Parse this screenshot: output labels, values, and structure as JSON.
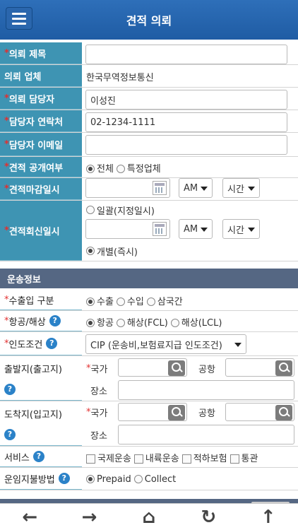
{
  "header": {
    "title": "견적 의뢰",
    "menu_icon": "hamburger-icon"
  },
  "fields": {
    "req_title": {
      "label": "의뢰 제목",
      "value": ""
    },
    "req_company": {
      "label": "의뢰 업체",
      "value": "한국무역정보통신"
    },
    "req_manager": {
      "label": "의뢰 담당자",
      "value": "이성진"
    },
    "contact": {
      "label": "담당자 연락처",
      "value": "02-1234-1111"
    },
    "email": {
      "label": "담당자 이메일",
      "value": ""
    },
    "open": {
      "label": "견적 공개여부",
      "opt1": "전체",
      "opt2": "특정업체"
    },
    "deadline": {
      "label": "견적마감일시",
      "ampm": "AM",
      "time": "시간"
    },
    "reply": {
      "label": "견적회신일시",
      "opt1": "일괄(지정일시)",
      "ampm": "AM",
      "time": "시간",
      "opt2": "개별(즉시)"
    }
  },
  "section": {
    "title": "운송정보"
  },
  "transport": {
    "io": {
      "label": "수출입 구분",
      "opt1": "수출",
      "opt2": "수입",
      "opt3": "삼국간"
    },
    "mode": {
      "label": "항공/해상",
      "opt1": "항공",
      "opt2": "해상(FCL)",
      "opt3": "해상(LCL)"
    },
    "incoterm": {
      "label": "인도조건",
      "value": "CIP (운송비,보험료지급 인도조건)"
    },
    "origin": {
      "label": "출발지(출고지)",
      "country": "국가",
      "port": "공항",
      "place": "장소"
    },
    "dest": {
      "label": "도착지(입고지)",
      "country": "국가",
      "port": "공항",
      "place": "장소"
    },
    "service": {
      "label": "서비스",
      "opt1": "국제운송",
      "opt2": "내륙운송",
      "opt3": "적하보험",
      "opt4": "통관"
    },
    "payment": {
      "label": "운임지불방법",
      "opt1": "Prepaid",
      "opt2": "Collect"
    }
  },
  "help_icon": "?",
  "nav": {
    "back": "←",
    "forward": "→",
    "home": "⌂",
    "refresh": "↻",
    "top": "↑"
  }
}
